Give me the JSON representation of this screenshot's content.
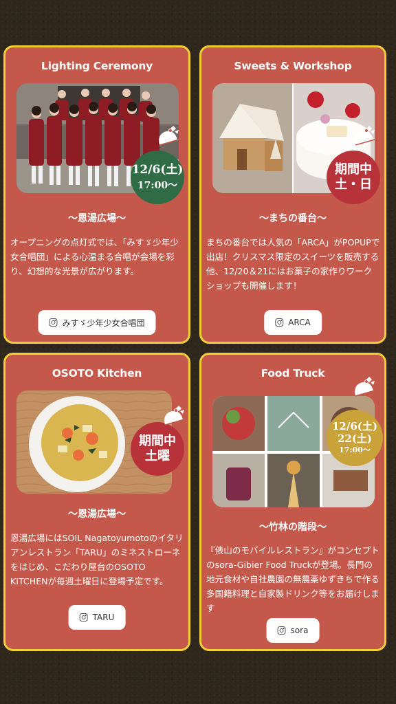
{
  "cards": [
    {
      "title": "Lighting Ceremony",
      "location": "〜恩湯広場〜",
      "description": "オープニングの点灯式では、「みすゞ少年少女合唱団」による心温まる合唱が会場を彩り、幻想的な光景が広がります。",
      "button_label": "みすゞ少年少女合唱団",
      "badge": {
        "line1": "12/6(土)",
        "line2": "17:00〜",
        "color": "#2f6b45"
      }
    },
    {
      "title": "Sweets & Workshop",
      "location": "〜まちの番台〜",
      "description": "まちの番台では人気の「ARCA」がPOPUPで出店！クリスマス限定のスイーツを販売する他、12/20＆21にはお菓子の家作りワークショップも開催します！",
      "button_label": "ARCA",
      "badge": {
        "line1": "期間中",
        "line2": "土・日",
        "color": "#b8323a"
      }
    },
    {
      "title": "OSOTO Kitchen",
      "location": "〜恩湯広場〜",
      "description": "恩湯広場にはSOIL Nagatoyumotoのイタリアンレストラン「TARU」のミネストローネをはじめ、こだわり屋台のOSOTO KITCHENが毎週土曜日に登場予定です。",
      "button_label": "TARU",
      "badge": {
        "line1": "期間中",
        "line2": "土曜",
        "color": "#b8323a"
      }
    },
    {
      "title": "Food Truck",
      "location": "〜竹林の階段〜",
      "description": "『俵山のモバイルレストラン』がコンセプトのsora-Gibier Food Truckが登場。長門の地元食材や自社農園の無農薬ゆずきちで作る多国籍料理と自家製ドリンク等をお届けします",
      "button_label": "sora",
      "badge": {
        "line1": "12/6(土)",
        "line2": "22(土)",
        "line3": "17:00〜",
        "color": "#c9a23a"
      }
    }
  ],
  "colors": {
    "card_bg": "#c4584b",
    "card_border": "#f2cf38",
    "page_bg": "#2f271c"
  }
}
